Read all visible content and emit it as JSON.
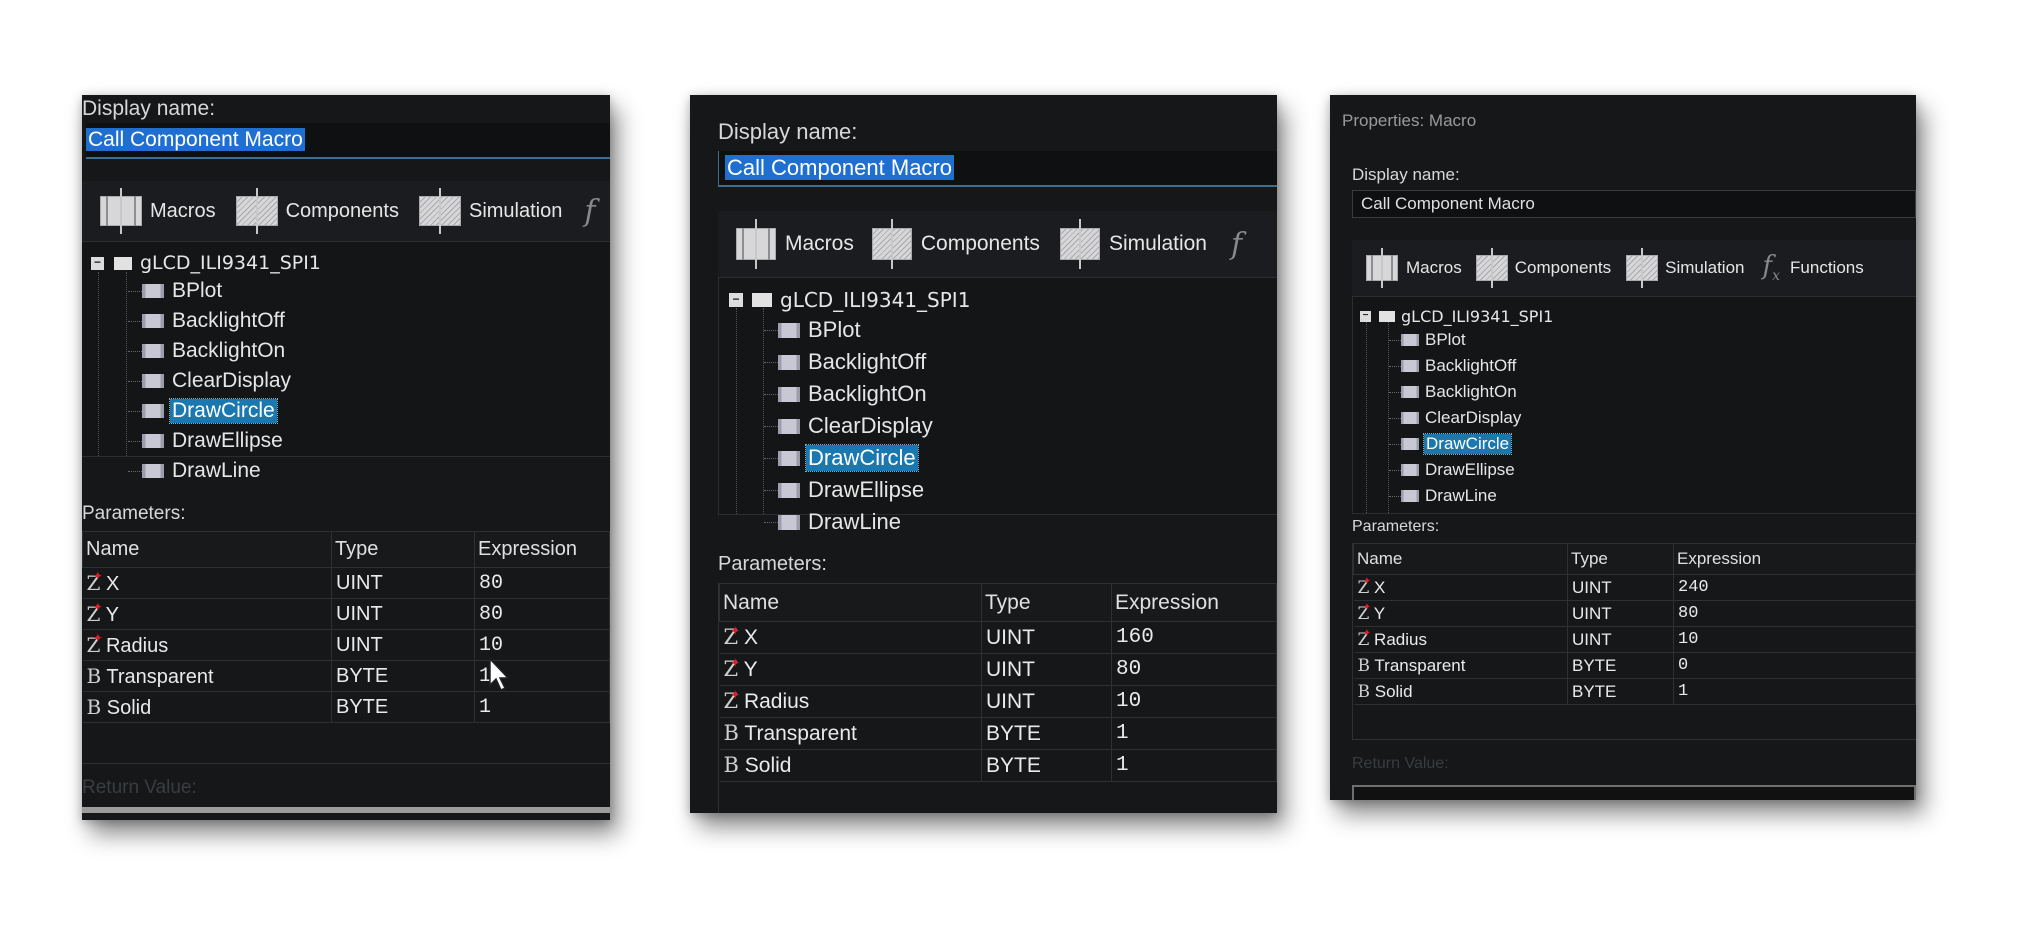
{
  "panels": [
    {
      "title": "",
      "display_name_label": "Display name:",
      "display_name_value": "Call Component Macro",
      "tabs": [
        {
          "label": "Macros",
          "icon": "macros-icon"
        },
        {
          "label": "Components",
          "icon": "components-icon"
        },
        {
          "label": "Simulation",
          "icon": "simulation-icon"
        },
        {
          "label": "",
          "icon": "fx-icon"
        }
      ],
      "tree": {
        "root": "gLCD_ILI9341_SPI1",
        "items": [
          "BPlot",
          "BacklightOff",
          "BacklightOn",
          "ClearDisplay",
          "DrawCircle",
          "DrawEllipse",
          "DrawLine"
        ],
        "selected": "DrawCircle"
      },
      "parameters_label": "Parameters:",
      "columns": [
        "Name",
        "Type",
        "Expression"
      ],
      "rows": [
        {
          "icon": "uint-icon",
          "name": "X",
          "type": "UINT",
          "expression": "80"
        },
        {
          "icon": "uint-icon",
          "name": "Y",
          "type": "UINT",
          "expression": "80"
        },
        {
          "icon": "uint-icon",
          "name": "Radius",
          "type": "UINT",
          "expression": "10"
        },
        {
          "icon": "byte-icon",
          "name": "Transparent",
          "type": "BYTE",
          "expression": "1"
        },
        {
          "icon": "byte-icon",
          "name": "Solid",
          "type": "BYTE",
          "expression": "1"
        }
      ],
      "return_value_label": "Return Value:"
    },
    {
      "title": "",
      "display_name_label": "Display name:",
      "display_name_value": "Call Component Macro",
      "tabs": [
        {
          "label": "Macros",
          "icon": "macros-icon"
        },
        {
          "label": "Components",
          "icon": "components-icon"
        },
        {
          "label": "Simulation",
          "icon": "simulation-icon"
        },
        {
          "label": "",
          "icon": "fx-icon"
        }
      ],
      "tree": {
        "root": "gLCD_ILI9341_SPI1",
        "items": [
          "BPlot",
          "BacklightOff",
          "BacklightOn",
          "ClearDisplay",
          "DrawCircle",
          "DrawEllipse",
          "DrawLine"
        ],
        "selected": "DrawCircle"
      },
      "parameters_label": "Parameters:",
      "columns": [
        "Name",
        "Type",
        "Expression"
      ],
      "rows": [
        {
          "icon": "uint-icon",
          "name": "X",
          "type": "UINT",
          "expression": "160"
        },
        {
          "icon": "uint-icon",
          "name": "Y",
          "type": "UINT",
          "expression": "80"
        },
        {
          "icon": "uint-icon",
          "name": "Radius",
          "type": "UINT",
          "expression": "10"
        },
        {
          "icon": "byte-icon",
          "name": "Transparent",
          "type": "BYTE",
          "expression": "1"
        },
        {
          "icon": "byte-icon",
          "name": "Solid",
          "type": "BYTE",
          "expression": "1"
        }
      ],
      "return_value_label": ""
    },
    {
      "title": "Properties: Macro",
      "display_name_label": "Display name:",
      "display_name_value": "Call Component Macro",
      "tabs": [
        {
          "label": "Macros",
          "icon": "macros-icon"
        },
        {
          "label": "Components",
          "icon": "components-icon"
        },
        {
          "label": "Simulation",
          "icon": "simulation-icon"
        },
        {
          "label": "Functions",
          "icon": "fx-icon"
        }
      ],
      "tree": {
        "root": "gLCD_ILI9341_SPI1",
        "items": [
          "BPlot",
          "BacklightOff",
          "BacklightOn",
          "ClearDisplay",
          "DrawCircle",
          "DrawEllipse",
          "DrawLine"
        ],
        "selected": "DrawCircle"
      },
      "parameters_label": "Parameters:",
      "columns": [
        "Name",
        "Type",
        "Expression"
      ],
      "rows": [
        {
          "icon": "uint-icon",
          "name": "X",
          "type": "UINT",
          "expression": "240"
        },
        {
          "icon": "uint-icon",
          "name": "Y",
          "type": "UINT",
          "expression": "80"
        },
        {
          "icon": "uint-icon",
          "name": "Radius",
          "type": "UINT",
          "expression": "10"
        },
        {
          "icon": "byte-icon",
          "name": "Transparent",
          "type": "BYTE",
          "expression": "0"
        },
        {
          "icon": "byte-icon",
          "name": "Solid",
          "type": "BYTE",
          "expression": "1"
        }
      ],
      "return_value_label": "Return Value:"
    }
  ],
  "colors": {
    "panel_bg": "#151719",
    "selection": "#1a78b0",
    "text_selection": "#1f6fd1",
    "uint_star": "#e01c24"
  }
}
